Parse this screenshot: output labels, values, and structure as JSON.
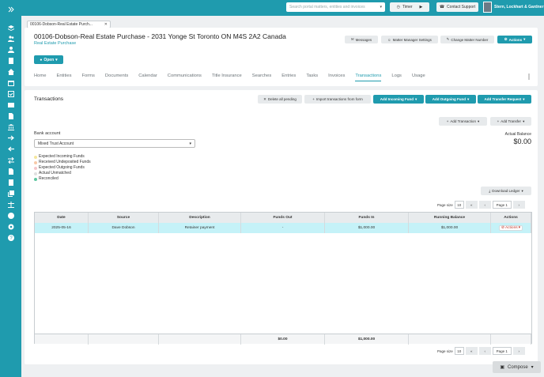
{
  "topbar": {
    "search_placeholder": "Search portal matters, entities and invoices",
    "timer_label": "Timer",
    "contact_label": "Contact Support",
    "user_name": "Stern, Lockhart & Gardner"
  },
  "matter_tab": {
    "label": "00106-Dobson-Real Estate Purch..."
  },
  "header": {
    "title": "00106-Dobson-Real Estate Purchase - 2031 Yonge St Toronto ON M4S 2A2 Canada",
    "subtitle": "Real Estate Purchase",
    "messages": "Messages",
    "matter_manager": "Matter Manager Settings",
    "change_number": "Change Matter Number",
    "actions": "Actions",
    "open": "Open"
  },
  "nav": {
    "tabs": [
      "Home",
      "Entities",
      "Forms",
      "Documents",
      "Calendar",
      "Communications",
      "Title Insurance",
      "Searches",
      "Entries",
      "Tasks",
      "Invoices",
      "Transactions",
      "Logs",
      "Usage"
    ],
    "active": "Transactions"
  },
  "transactions": {
    "title": "Transactions",
    "delete_pending": "Delete all pending",
    "import": "Import transactions from form",
    "add_incoming": "Add Incoming Fund",
    "add_outgoing": "Add Outgoing Fund",
    "add_transfer_request": "Add Transfer Request",
    "add_transaction": "Add Transaction",
    "add_transfer": "Add Transfer",
    "bank_account_label": "Bank account",
    "bank_account_value": "Mixed Trust Account",
    "balance_label": "Actual Balance",
    "balance_value": "$0.00",
    "legend": [
      {
        "label": "Expected Incoming Funds",
        "color": "#f5e79e"
      },
      {
        "label": "Received Undeposited Funds",
        "color": "#f7c9a8"
      },
      {
        "label": "Expected Outgoing Funds",
        "color": "#f5c6cb"
      },
      {
        "label": "Actual Unmatched",
        "color": "#e0e0e0"
      },
      {
        "label": "Reconciled",
        "color": "#5fc7a0"
      }
    ],
    "download_ledger": "Download Ledger",
    "page_size_label": "Page size",
    "page_size": "10",
    "page_label": "Page 1",
    "columns": [
      "Date",
      "Source",
      "Description",
      "Funds Out",
      "Funds In",
      "Running Balance",
      "Actions"
    ],
    "rows": [
      [
        "2025-05-16",
        "Dave Dobson",
        "Retainer payment",
        "-",
        "$1,000.00",
        "$1,000.00",
        "Actions"
      ]
    ],
    "totals": [
      "",
      "",
      "",
      "$0.00",
      "$1,000.00",
      "",
      ""
    ]
  },
  "compose": {
    "label": "Compose"
  }
}
